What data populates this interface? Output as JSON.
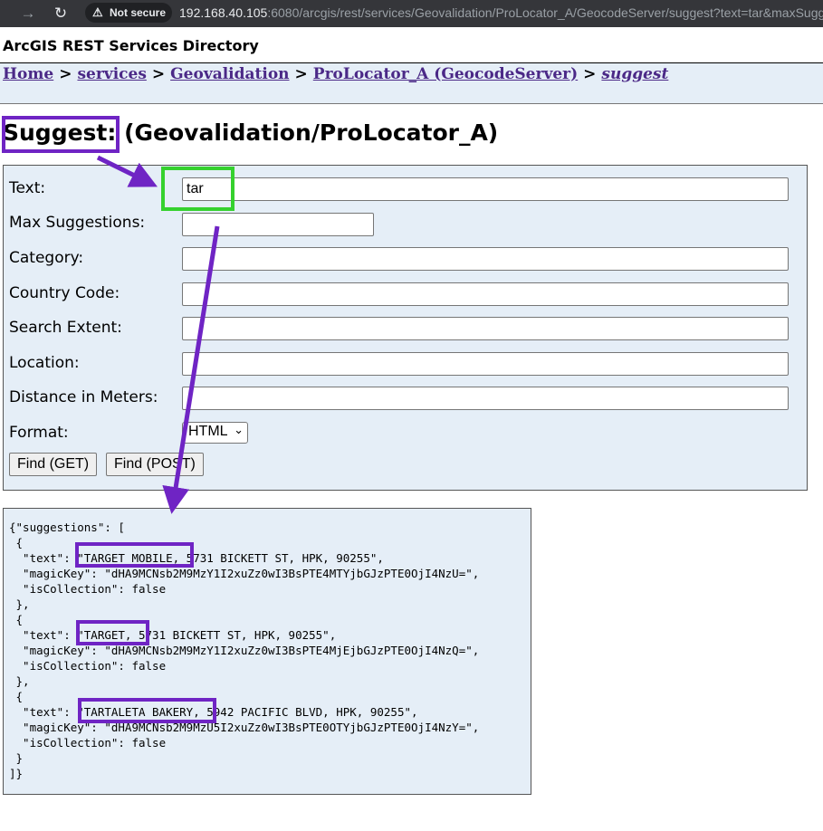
{
  "browser": {
    "security_label": "Not secure",
    "url_host": "192.168.40.105",
    "url_rest": ":6080/arcgis/rest/services/Geovalidation/ProLocator_A/GeocodeServer/suggest?text=tar&maxSugge"
  },
  "page": {
    "directory_title": "ArcGIS REST Services Directory",
    "breadcrumb": {
      "home": "Home",
      "services": "services",
      "folder": "Geovalidation",
      "service": "ProLocator_A (GeocodeServer)",
      "current": "suggest",
      "separator": ">"
    },
    "heading": {
      "op": "Suggest:",
      "service": "(Geovalidation/ProLocator_A)"
    }
  },
  "form": {
    "fields": [
      {
        "label": "Text:",
        "value": "tar"
      },
      {
        "label": "Max Suggestions:",
        "value": ""
      },
      {
        "label": "Category:",
        "value": ""
      },
      {
        "label": "Country Code:",
        "value": ""
      },
      {
        "label": "Search Extent:",
        "value": ""
      },
      {
        "label": "Location:",
        "value": ""
      },
      {
        "label": "Distance in Meters:",
        "value": ""
      }
    ],
    "format_label": "Format:",
    "format_value": "HTML",
    "find_get": "Find (GET)",
    "find_post": "Find (POST)"
  },
  "result": {
    "lines": [
      "{\"suggestions\": [",
      " {",
      "  \"text\": \"TARGET MOBILE, 5731 BICKETT ST, HPK, 90255\",",
      "  \"magicKey\": \"dHA9MCNsb2M9MzY1I2xuZz0wI3BsPTE4MTYjbGJzPTE0OjI4NzU=\",",
      "  \"isCollection\": false",
      " },",
      " {",
      "  \"text\": \"TARGET, 5731 BICKETT ST, HPK, 90255\",",
      "  \"magicKey\": \"dHA9MCNsb2M9MzY1I2xuZz0wI3BsPTE4MjEjbGJzPTE0OjI4NzQ=\",",
      "  \"isCollection\": false",
      " },",
      " {",
      "  \"text\": \"TARTALETA BAKERY, 5942 PACIFIC BLVD, HPK, 90255\",",
      "  \"magicKey\": \"dHA9MCNsb2M9MzU5I2xuZz0wI3BsPTE0OTYjbGJzPTE0OjI4NzY=\",",
      "  \"isCollection\": false",
      " }",
      "]}"
    ]
  },
  "colors": {
    "annotation_purple": "#6f24c4",
    "annotation_green": "#35d12e",
    "panel_background": "#e5eef7",
    "link": "#4b2987"
  }
}
